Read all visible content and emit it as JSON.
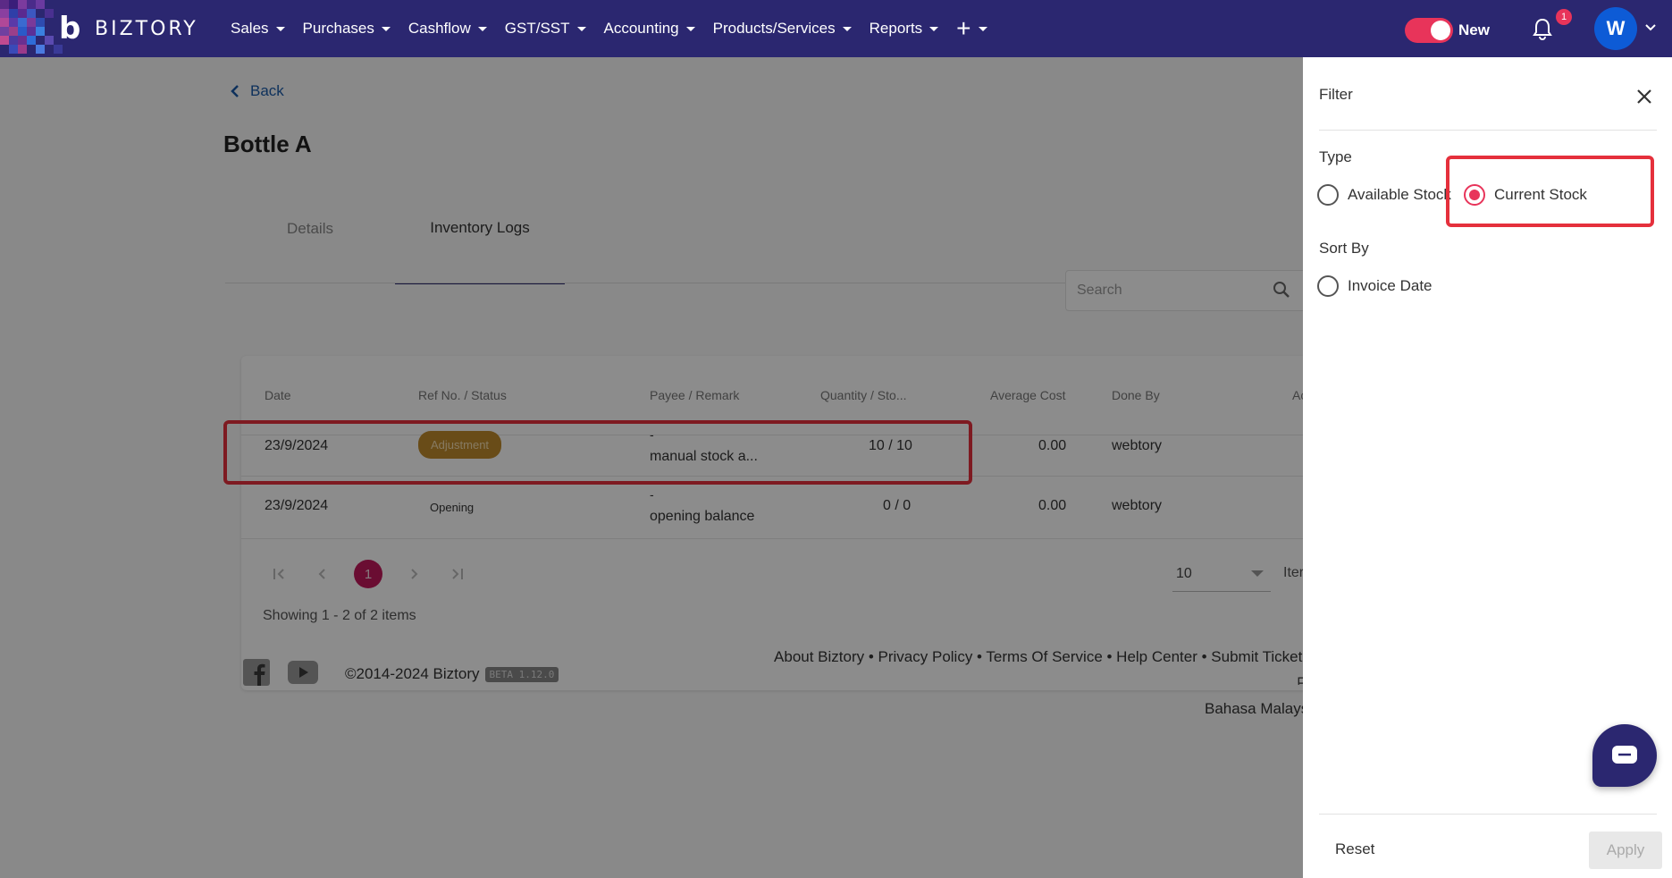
{
  "brand": {
    "name": "BIZTORY"
  },
  "nav": {
    "items": [
      {
        "label": "Sales"
      },
      {
        "label": "Purchases"
      },
      {
        "label": "Cashflow"
      },
      {
        "label": "GST/SST"
      },
      {
        "label": "Accounting"
      },
      {
        "label": "Products/Services"
      },
      {
        "label": "Reports"
      }
    ],
    "toggle_label": "New",
    "notifications_count": "1",
    "avatar_initial": "W"
  },
  "page": {
    "back_label": "Back",
    "title": "Bottle A",
    "tabs": [
      {
        "label": "Details"
      },
      {
        "label": "Inventory Logs",
        "active": true
      }
    ],
    "search_placeholder": "Search"
  },
  "table": {
    "columns": [
      "Date",
      "Ref No. / Status",
      "Payee / Remark",
      "Quantity / Sto...",
      "Average Cost",
      "Done By",
      "Ac"
    ],
    "rows": [
      {
        "date": "23/9/2024",
        "status": "Adjustment",
        "payee": "-",
        "remark": "manual stock a...",
        "quantity": "10 / 10",
        "avg_cost": "0.00",
        "done_by": "webtory"
      },
      {
        "date": "23/9/2024",
        "status": "Opening",
        "payee": "-",
        "remark": "opening balance",
        "quantity": "0 / 0",
        "avg_cost": "0.00",
        "done_by": "webtory"
      }
    ],
    "current_page": "1",
    "per_page": "10",
    "items_label": "Iter",
    "showing": "Showing 1 - 2 of 2 items"
  },
  "footer": {
    "copyright": "©2014-2024 Biztory",
    "beta": "BETA 1.12.0",
    "links_line1": "About Biztory • Privacy Policy • Terms Of Service • Help Center • Submit Ticket • 中",
    "links_line2": "Bahasa Malaysi"
  },
  "filter": {
    "title": "Filter",
    "type_label": "Type",
    "type_options": [
      {
        "label": "Available Stock",
        "selected": false
      },
      {
        "label": "Current Stock",
        "selected": true
      }
    ],
    "sort_label": "Sort By",
    "sort_options": [
      {
        "label": "Invoice Date",
        "selected": false
      }
    ],
    "reset_label": "Reset",
    "apply_label": "Apply"
  },
  "colors": {
    "nav_bg": "#2b2770",
    "accent": "#e8345a",
    "highlight": "#e5303c",
    "adjustment_badge": "#c08a2c"
  }
}
